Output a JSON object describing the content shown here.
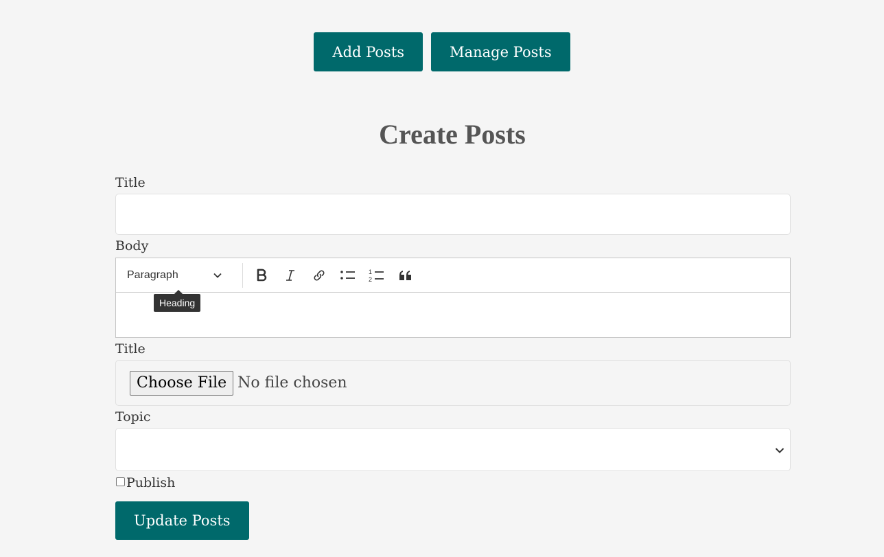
{
  "nav": {
    "add_posts": "Add Posts",
    "manage_posts": "Manage Posts"
  },
  "page_title": "Create Posts",
  "form": {
    "title_label": "Title",
    "title_value": "",
    "body_label": "Body",
    "editor": {
      "heading_select": "Paragraph",
      "tooltip": "Heading",
      "tools": [
        "bold-icon",
        "italic-icon",
        "link-icon",
        "bulleted-list-icon",
        "numbered-list-icon",
        "quote-icon"
      ]
    },
    "image_label": "Title",
    "file_button": "Choose File",
    "file_status": "No file chosen",
    "topic_label": "Topic",
    "topic_value": "",
    "publish_label": "Publish",
    "publish_checked": false,
    "submit": "Update Posts"
  },
  "colors": {
    "accent": "#00696b",
    "background": "#f5f5f5"
  }
}
